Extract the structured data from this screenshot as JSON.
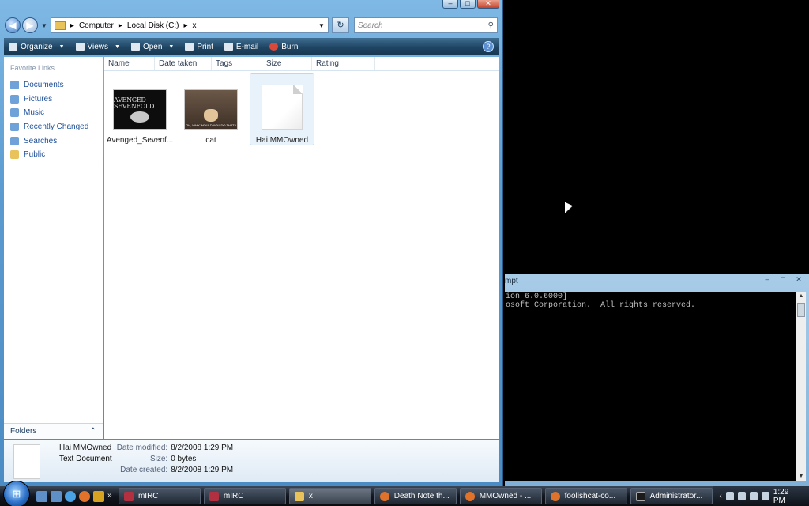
{
  "explorer": {
    "breadcrumb": [
      "Computer",
      "Local Disk (C:)",
      "x"
    ],
    "search_placeholder": "Search",
    "toolbar": {
      "organize": "Organize",
      "views": "Views",
      "open": "Open",
      "print": "Print",
      "email": "E-mail",
      "burn": "Burn"
    },
    "sidebar": {
      "header": "Favorite Links",
      "links": [
        "Documents",
        "Pictures",
        "Music",
        "Recently Changed",
        "Searches",
        "Public"
      ],
      "folders_label": "Folders"
    },
    "columns": [
      "Name",
      "Date taken",
      "Tags",
      "Size",
      "Rating"
    ],
    "items": [
      {
        "name": "Avenged_Sevenf...",
        "thumb_text": "AVENGED SEVENFOLD"
      },
      {
        "name": "cat",
        "thumb_text": "OH, WHY WOULD YOU DO THAT?"
      },
      {
        "name": "Hai MMOwned"
      }
    ],
    "details": {
      "name": "Hai MMOwned",
      "type": "Text Document",
      "labels": [
        "Date modified:",
        "Size:",
        "Date created:"
      ],
      "values": [
        "8/2/2008 1:29 PM",
        "0 bytes",
        "8/2/2008 1:29 PM"
      ]
    }
  },
  "cmd": {
    "title": "mpt",
    "lines": [
      "ion 6.0.6000]",
      "osoft Corporation.  All rights reserved."
    ]
  },
  "taskbar": {
    "tasks": [
      "mIRC",
      "mIRC",
      "x",
      "Death Note th...",
      "MMOwned - ...",
      "foolishcat-co...",
      "Administrator..."
    ],
    "clock": "1:29 PM"
  }
}
